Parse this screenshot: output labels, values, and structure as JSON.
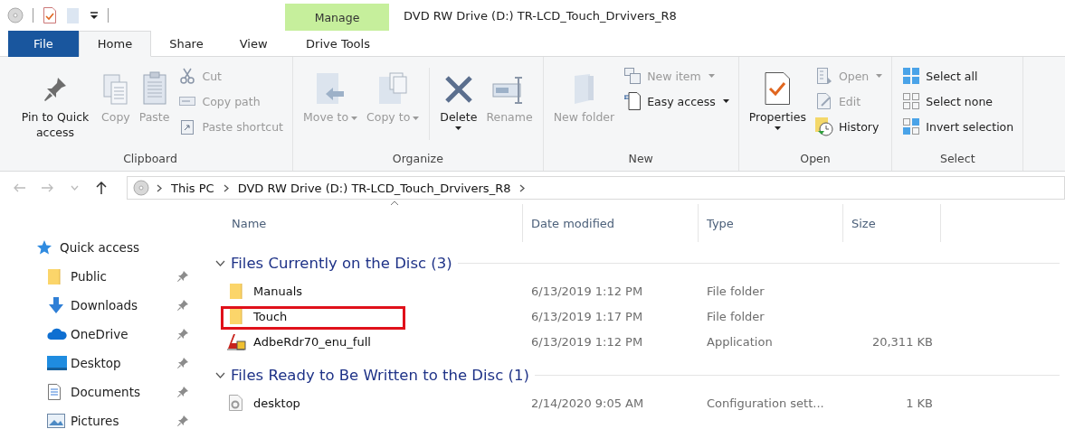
{
  "window": {
    "title": "DVD RW Drive (D:) TR-LCD_Touch_Drvivers_R8",
    "context_tab_header": "Manage"
  },
  "tabs": [
    {
      "label": "File",
      "kind": "file",
      "selected": false
    },
    {
      "label": "Home",
      "kind": "normal",
      "selected": true
    },
    {
      "label": "Share",
      "kind": "normal",
      "selected": false
    },
    {
      "label": "View",
      "kind": "normal",
      "selected": false
    },
    {
      "label": "Drive Tools",
      "kind": "context",
      "selected": false
    }
  ],
  "ribbon": {
    "groups": [
      {
        "label": "Clipboard",
        "items": [
          {
            "kind": "large",
            "label": "Pin to Quick access",
            "disabled": false,
            "caret": false
          },
          {
            "kind": "large",
            "label": "Copy",
            "disabled": true,
            "caret": false
          },
          {
            "kind": "large",
            "label": "Paste",
            "disabled": true,
            "caret": false
          },
          {
            "kind": "stack",
            "items": [
              {
                "label": "Cut",
                "disabled": true,
                "caret": false
              },
              {
                "label": "Copy path",
                "disabled": true,
                "caret": false
              },
              {
                "label": "Paste shortcut",
                "disabled": true,
                "caret": false
              }
            ]
          }
        ]
      },
      {
        "label": "Organize",
        "items": [
          {
            "kind": "large",
            "label": "Move to",
            "disabled": true,
            "caret": true
          },
          {
            "kind": "large",
            "label": "Copy to",
            "disabled": true,
            "caret": true
          },
          {
            "kind": "separator"
          },
          {
            "kind": "split",
            "label": "Delete",
            "disabled": false,
            "caret": true
          },
          {
            "kind": "large",
            "label": "Rename",
            "disabled": true,
            "caret": false
          }
        ]
      },
      {
        "label": "New",
        "items": [
          {
            "kind": "large",
            "label": "New folder",
            "disabled": true,
            "caret": false
          },
          {
            "kind": "stack",
            "items": [
              {
                "label": "New item",
                "disabled": true,
                "caret": true
              },
              {
                "label": "Easy access",
                "disabled": false,
                "caret": true
              }
            ]
          }
        ]
      },
      {
        "label": "Open",
        "items": [
          {
            "kind": "split",
            "label": "Properties",
            "disabled": false,
            "caret": true
          },
          {
            "kind": "stack",
            "items": [
              {
                "label": "Open",
                "disabled": true,
                "caret": true
              },
              {
                "label": "Edit",
                "disabled": true,
                "caret": false
              },
              {
                "label": "History",
                "disabled": false,
                "caret": false
              }
            ]
          }
        ]
      },
      {
        "label": "Select",
        "items": [
          {
            "kind": "stack",
            "items": [
              {
                "label": "Select all",
                "disabled": false,
                "caret": false
              },
              {
                "label": "Select none",
                "disabled": false,
                "caret": false
              },
              {
                "label": "Invert selection",
                "disabled": false,
                "caret": false
              }
            ]
          }
        ]
      }
    ]
  },
  "address_bar": {
    "back_disabled": true,
    "forward_disabled": true,
    "path": [
      "This PC",
      "DVD RW Drive (D:) TR-LCD_Touch_Drvivers_R8"
    ]
  },
  "sidebar": {
    "items": [
      {
        "label": "Quick access",
        "kind": "header",
        "pinned": false
      },
      {
        "label": "Public",
        "kind": "folder",
        "pinned": true
      },
      {
        "label": "Downloads",
        "kind": "downloads",
        "pinned": true
      },
      {
        "label": "OneDrive",
        "kind": "cloud",
        "pinned": true
      },
      {
        "label": "Desktop",
        "kind": "desktop",
        "pinned": true
      },
      {
        "label": "Documents",
        "kind": "documents",
        "pinned": true
      },
      {
        "label": "Pictures",
        "kind": "pictures",
        "pinned": true
      }
    ]
  },
  "table": {
    "columns": [
      "Name",
      "Date modified",
      "Type",
      "Size"
    ],
    "groups": [
      {
        "title": "Files Currently on the Disc (3)",
        "expanded": true,
        "rows": [
          {
            "kind": "folder",
            "name": "Manuals",
            "date": "6/13/2019 1:12 PM",
            "type": "File folder",
            "highlighted": false
          },
          {
            "kind": "folder",
            "name": "Touch",
            "date": "6/13/2019 1:17 PM",
            "type": "File folder",
            "highlighted": true
          },
          {
            "kind": "application",
            "name": "AdbeRdr70_enu_full",
            "date": "6/13/2019 1:12 PM",
            "type": "Application",
            "size": "20,311 KB",
            "highlighted": false
          }
        ]
      },
      {
        "title": "Files Ready to Be Written to the Disc (1)",
        "expanded": true,
        "rows": [
          {
            "kind": "settings",
            "name": "desktop",
            "date": "2/14/2020 9:05 AM",
            "type": "Configuration sett...",
            "size": "1 KB",
            "highlighted": false
          }
        ]
      }
    ]
  }
}
